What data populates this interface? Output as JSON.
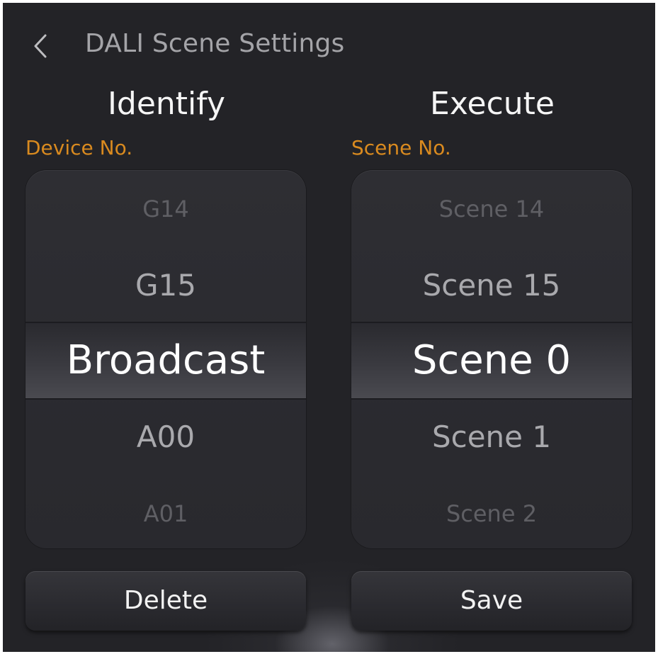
{
  "header": {
    "title": "DALI Scene Settings",
    "back_icon": "chevron-left-icon"
  },
  "identify": {
    "title": "Identify",
    "label": "Device No.",
    "items": [
      "G14",
      "G15",
      "Broadcast",
      "A00",
      "A01"
    ],
    "selected": "Broadcast",
    "button_label": "Delete"
  },
  "execute": {
    "title": "Execute",
    "label": "Scene No.",
    "items": [
      "Scene 14",
      "Scene 15",
      "Scene 0",
      "Scene 1",
      "Scene 2"
    ],
    "selected": "Scene 0",
    "button_label": "Save"
  },
  "colors": {
    "background": "#232327",
    "accent": "#d98a1f",
    "text_primary": "#ffffff",
    "text_secondary": "#a9a9ad",
    "text_faded": "#5f5f64"
  }
}
